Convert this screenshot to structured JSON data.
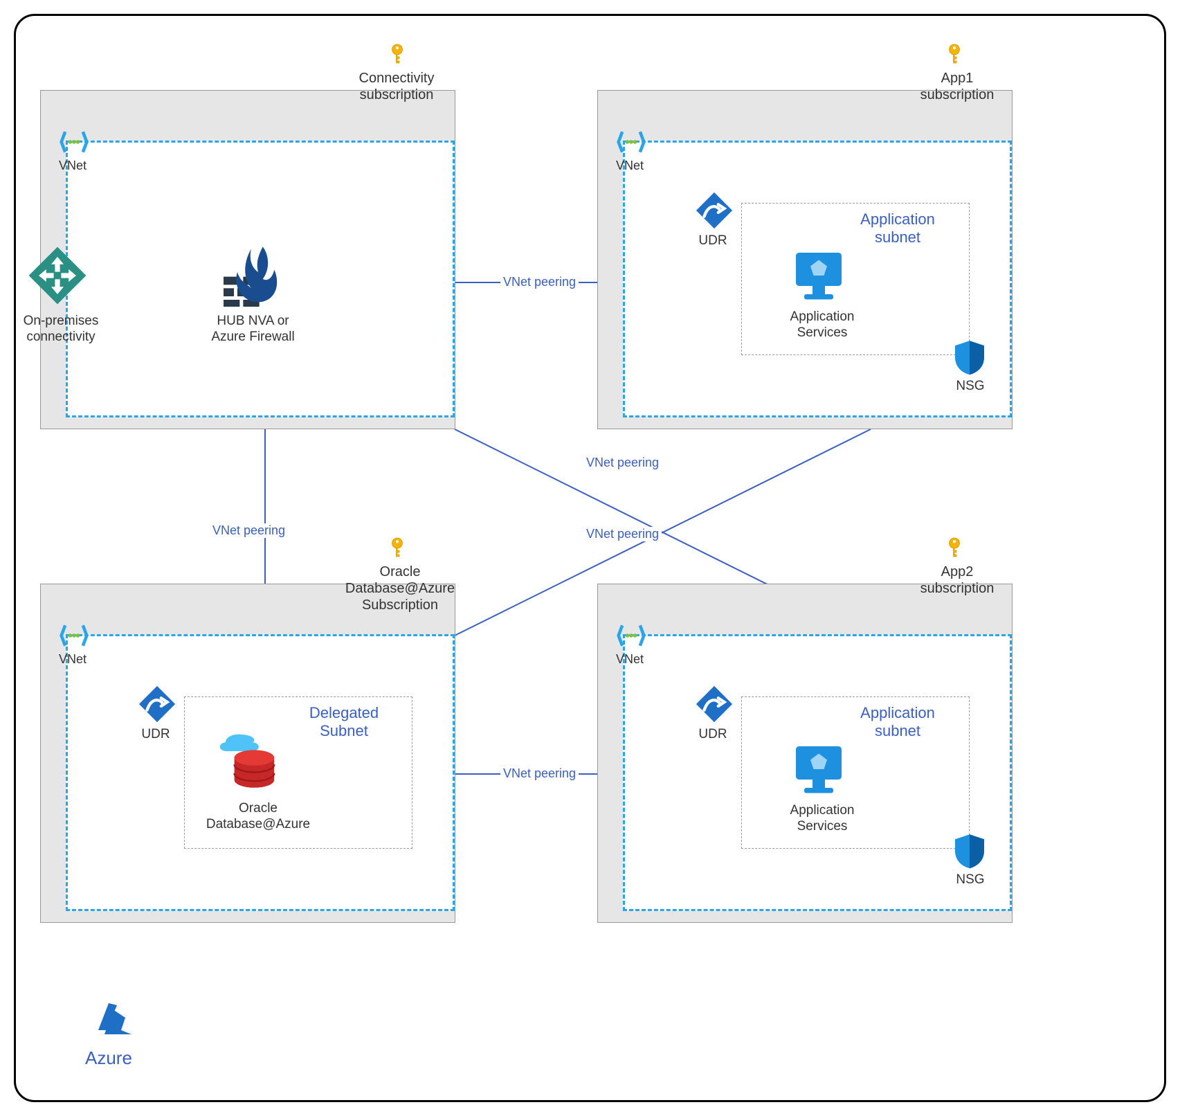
{
  "diagram": {
    "azure_label": "Azure",
    "peering_label": "VNet peering",
    "vnet_label": "VNet",
    "udr_label": "UDR",
    "nsg_label": "NSG"
  },
  "subscriptions": {
    "connectivity": {
      "label_l1": "Connectivity",
      "label_l2": "subscription",
      "firewall_l1": "HUB NVA or",
      "firewall_l2": "Azure Firewall",
      "onprem_l1": "On-premises",
      "onprem_l2": "connectivity"
    },
    "oracle": {
      "label_l1": "Oracle",
      "label_l2": "Database@Azure",
      "label_l3": "Subscription",
      "subnet_l1": "Delegated",
      "subnet_l2": "Subnet",
      "db_l1": "Oracle",
      "db_l2": "Database@Azure"
    },
    "app1": {
      "label_l1": "App1",
      "label_l2": "subscription",
      "subnet_l1": "Application",
      "subnet_l2": "subnet",
      "svc_l1": "Application",
      "svc_l2": "Services"
    },
    "app2": {
      "label_l1": "App2",
      "label_l2": "subscription",
      "subnet_l1": "Application",
      "subnet_l2": "subnet",
      "svc_l1": "Application",
      "svc_l2": "Services"
    }
  }
}
